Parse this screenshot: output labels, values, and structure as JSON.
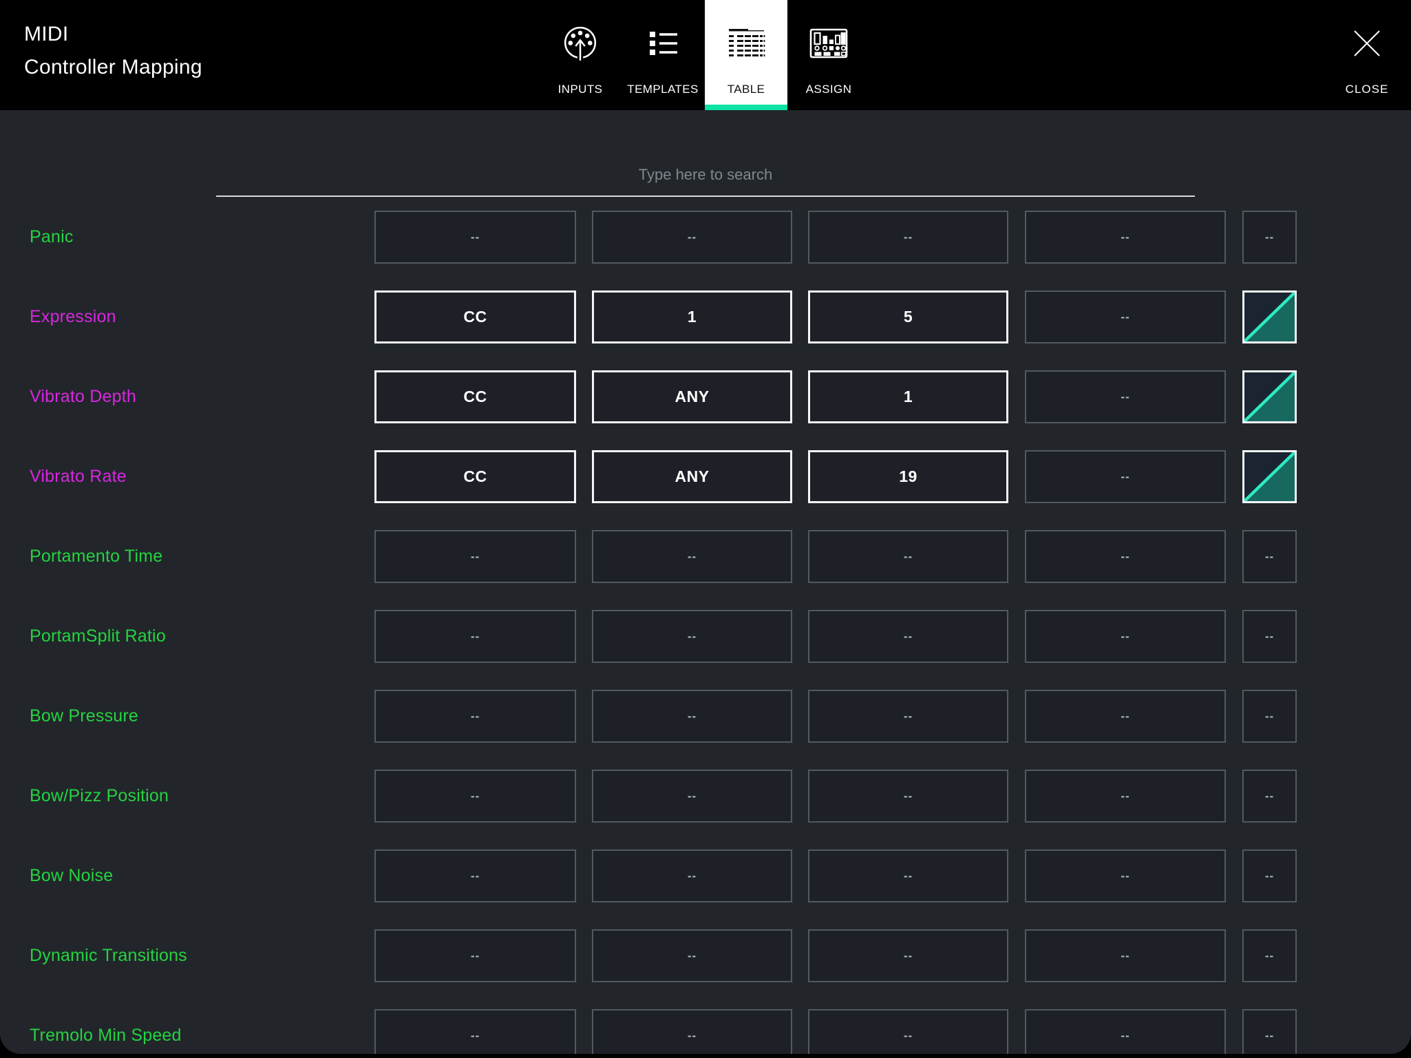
{
  "header": {
    "title_line1": "MIDI",
    "title_line2": "Controller Mapping",
    "tabs": [
      {
        "label": "INPUTS",
        "icon": "midi-din-icon",
        "active": false
      },
      {
        "label": "TEMPLATES",
        "icon": "list-icon",
        "active": false
      },
      {
        "label": "TABLE",
        "icon": "table-grid-icon",
        "active": true
      },
      {
        "label": "ASSIGN",
        "icon": "mixer-icon",
        "active": false
      }
    ],
    "close": {
      "label": "CLOSE",
      "icon": "close-x-icon"
    }
  },
  "search": {
    "placeholder": "Type here to search",
    "value": ""
  },
  "mapping_table": {
    "rows": [
      {
        "label": "Panic",
        "color": "green",
        "cells": [
          {
            "text": "--",
            "active": false
          },
          {
            "text": "--",
            "active": false
          },
          {
            "text": "--",
            "active": false
          },
          {
            "text": "--",
            "active": false
          }
        ],
        "last": {
          "type": "text",
          "text": "--",
          "active": false
        }
      },
      {
        "label": "Expression",
        "color": "magenta",
        "cells": [
          {
            "text": "CC",
            "active": true
          },
          {
            "text": "1",
            "active": true
          },
          {
            "text": "5",
            "active": true
          },
          {
            "text": "--",
            "active": false
          }
        ],
        "last": {
          "type": "curve",
          "active": true
        }
      },
      {
        "label": "Vibrato Depth",
        "color": "magenta",
        "cells": [
          {
            "text": "CC",
            "active": true
          },
          {
            "text": "ANY",
            "active": true
          },
          {
            "text": "1",
            "active": true
          },
          {
            "text": "--",
            "active": false
          }
        ],
        "last": {
          "type": "curve",
          "active": true
        }
      },
      {
        "label": "Vibrato Rate",
        "color": "magenta",
        "cells": [
          {
            "text": "CC",
            "active": true
          },
          {
            "text": "ANY",
            "active": true
          },
          {
            "text": "19",
            "active": true
          },
          {
            "text": "--",
            "active": false
          }
        ],
        "last": {
          "type": "curve",
          "active": true
        }
      },
      {
        "label": "Portamento Time",
        "color": "green",
        "cells": [
          {
            "text": "--",
            "active": false
          },
          {
            "text": "--",
            "active": false
          },
          {
            "text": "--",
            "active": false
          },
          {
            "text": "--",
            "active": false
          }
        ],
        "last": {
          "type": "text",
          "text": "--",
          "active": false
        }
      },
      {
        "label": "PortamSplit Ratio",
        "color": "green",
        "cells": [
          {
            "text": "--",
            "active": false
          },
          {
            "text": "--",
            "active": false
          },
          {
            "text": "--",
            "active": false
          },
          {
            "text": "--",
            "active": false
          }
        ],
        "last": {
          "type": "text",
          "text": "--",
          "active": false
        }
      },
      {
        "label": "Bow Pressure",
        "color": "green",
        "cells": [
          {
            "text": "--",
            "active": false
          },
          {
            "text": "--",
            "active": false
          },
          {
            "text": "--",
            "active": false
          },
          {
            "text": "--",
            "active": false
          }
        ],
        "last": {
          "type": "text",
          "text": "--",
          "active": false
        }
      },
      {
        "label": "Bow/Pizz Position",
        "color": "green",
        "cells": [
          {
            "text": "--",
            "active": false
          },
          {
            "text": "--",
            "active": false
          },
          {
            "text": "--",
            "active": false
          },
          {
            "text": "--",
            "active": false
          }
        ],
        "last": {
          "type": "text",
          "text": "--",
          "active": false
        }
      },
      {
        "label": "Bow Noise",
        "color": "green",
        "cells": [
          {
            "text": "--",
            "active": false
          },
          {
            "text": "--",
            "active": false
          },
          {
            "text": "--",
            "active": false
          },
          {
            "text": "--",
            "active": false
          }
        ],
        "last": {
          "type": "text",
          "text": "--",
          "active": false
        }
      },
      {
        "label": "Dynamic Transitions",
        "color": "green",
        "cells": [
          {
            "text": "--",
            "active": false
          },
          {
            "text": "--",
            "active": false
          },
          {
            "text": "--",
            "active": false
          },
          {
            "text": "--",
            "active": false
          }
        ],
        "last": {
          "type": "text",
          "text": "--",
          "active": false
        }
      },
      {
        "label": "Tremolo Min Speed",
        "color": "green",
        "cells": [
          {
            "text": "--",
            "active": false
          },
          {
            "text": "--",
            "active": false
          },
          {
            "text": "--",
            "active": false
          },
          {
            "text": "--",
            "active": false
          }
        ],
        "last": {
          "type": "text",
          "text": "--",
          "active": false
        }
      }
    ]
  },
  "colors": {
    "header_bg": "#000000",
    "content_bg": "#22262b",
    "cell_bg": "#1d2127",
    "accent": "#0ce3a4",
    "green_label": "#25d340",
    "magenta_label": "#d826e0",
    "curve_line": "#2fe9c1",
    "curve_fill": "#17685f",
    "curve_bg": "#1b2531",
    "active_border": "#f3f5f6",
    "inactive_border": "#525960",
    "dash_text": "#b5bac0"
  },
  "layout_note_values": {
    "row_count": 11
  }
}
